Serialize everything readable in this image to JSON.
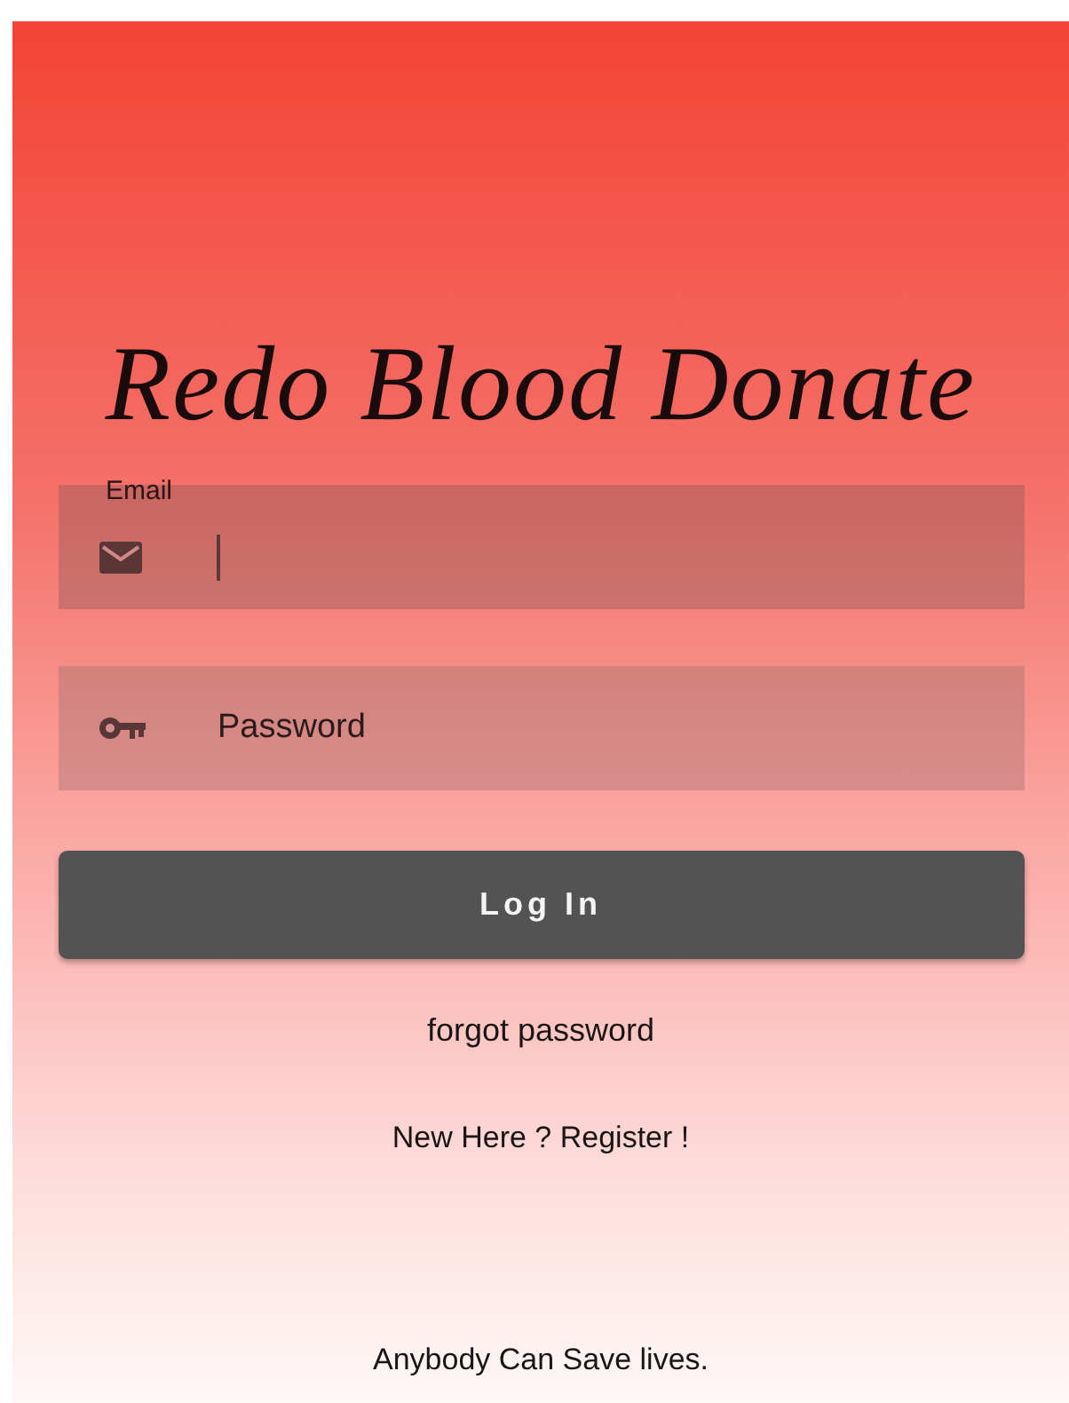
{
  "app_title": "Redo Blood Donate",
  "fields": [
    {
      "kind": "email",
      "label": "Email",
      "focused": true
    },
    {
      "kind": "password",
      "placeholder": "Password",
      "focused": false
    }
  ],
  "login_button": "Log In",
  "links": [
    "forgot password",
    "New Here ? Register !"
  ],
  "tagline": "Anybody Can Save lives."
}
